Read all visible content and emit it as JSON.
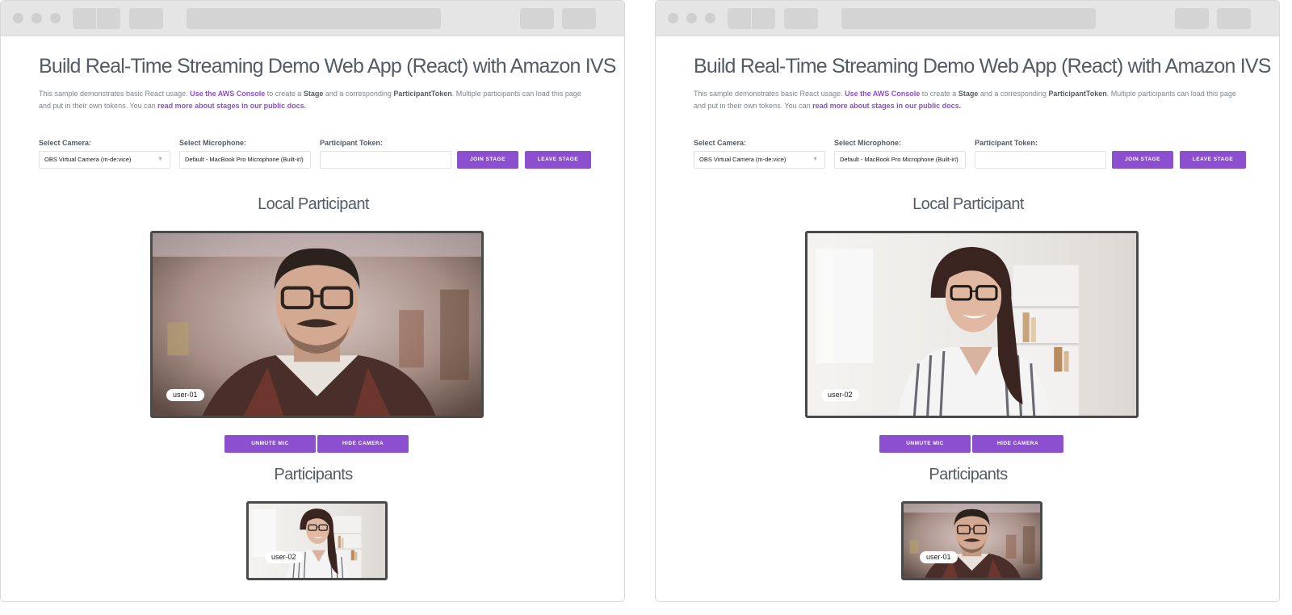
{
  "windows": [
    {
      "title": "Build Real-Time Streaming Demo Web App (React) with Amazon IVS",
      "intro": {
        "t1": "This sample demonstrates basic React usage. ",
        "link1": "Use the AWS Console",
        "t2": " to create a ",
        "b1": "Stage",
        "t3": " and a corresponding ",
        "b2": "ParticipantToken",
        "t4": ". Multiple participants can load this page and put in their own tokens. You can ",
        "link2": "read more about stages in our public docs."
      },
      "camera_label": "Select Camera:",
      "camera_value": "OBS Virtual Camera (m-de:vice)",
      "mic_label": "Select Microphone:",
      "mic_value": "Default - MacBook Pro Microphone (Built-in)",
      "token_label": "Participant Token:",
      "token_value": "",
      "join_label": "JOIN STAGE",
      "leave_label": "LEAVE STAGE",
      "local_heading": "Local Participant",
      "local_user": "user-01",
      "unmute_label": "UNMUTE MIC",
      "hide_camera_label": "HIDE CAMERA",
      "participants_heading": "Participants",
      "remote_user": "user-02"
    },
    {
      "title": "Build Real-Time Streaming Demo Web App (React) with Amazon IVS",
      "intro": {
        "t1": "This sample demonstrates basic React usage. ",
        "link1": "Use the AWS Console",
        "t2": " to create a ",
        "b1": "Stage",
        "t3": " and a corresponding ",
        "b2": "ParticipantToken",
        "t4": ". Multiple participants can load this page and put in their own tokens. You can ",
        "link2": "read more about stages in our public docs."
      },
      "camera_label": "Select Camera:",
      "camera_value": "OBS Virtual Camera (m-de:vice)",
      "mic_label": "Select Microphone:",
      "mic_value": "Default - MacBook Pro Microphone (Built-in)",
      "token_label": "Participant Token:",
      "token_value": "",
      "join_label": "JOIN STAGE",
      "leave_label": "LEAVE STAGE",
      "local_heading": "Local Participant",
      "local_user": "user-02",
      "unmute_label": "UNMUTE MIC",
      "hide_camera_label": "HIDE CAMERA",
      "participants_heading": "Participants",
      "remote_user": "user-01"
    }
  ],
  "icons": {
    "select_chevron": "chevron-down-icon",
    "traffic_lights": "window-control-icon"
  },
  "colors": {
    "accent": "#8c4fcf",
    "text": "#545b64",
    "chrome": "#e5e5e5",
    "video_border": "#4a4a4a"
  }
}
